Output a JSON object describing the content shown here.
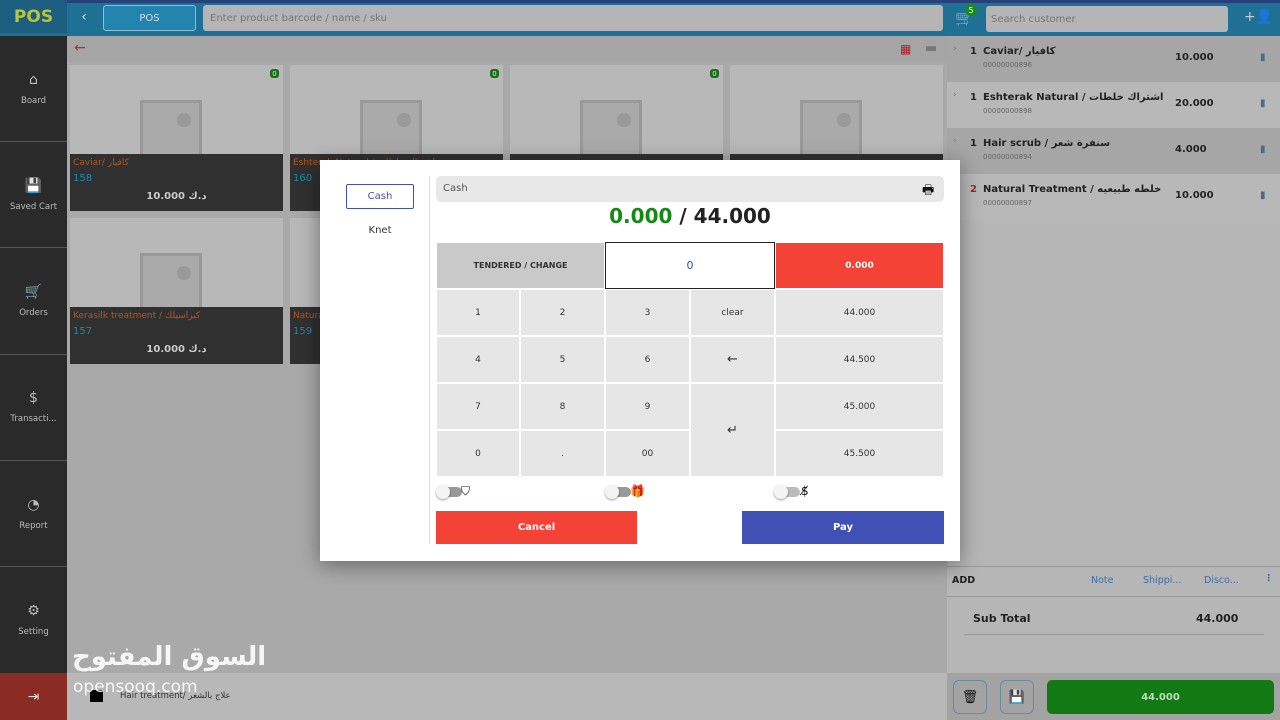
{
  "header": {
    "logo": "POS",
    "back_icon": "chevron-left",
    "pos_label": "POS",
    "product_search_placeholder": "Enter product barcode / name / sku",
    "cart_count": "5",
    "customer_search_placeholder": "Search customer"
  },
  "sidebar": {
    "items": [
      {
        "label": "Board",
        "icon": "⌂"
      },
      {
        "label": "Saved Cart",
        "icon": "💾"
      },
      {
        "label": "Orders",
        "icon": "🛒"
      },
      {
        "label": "Transacti...",
        "icon": "$"
      },
      {
        "label": "Report",
        "icon": "◔"
      },
      {
        "label": "Setting",
        "icon": "⚙"
      }
    ],
    "logout_icon": "⇥"
  },
  "products": [
    {
      "name": "Caviar/ كافيار",
      "code": "158",
      "price": "10.000 د.ك",
      "badge": "0"
    },
    {
      "name": "Eshterak Natural / اشتراك خلطات",
      "code": "160",
      "price": "",
      "badge": "0"
    },
    {
      "name": "",
      "code": "",
      "price": "",
      "badge": "0"
    },
    {
      "name": "",
      "code": "",
      "price": "",
      "badge": ""
    },
    {
      "name": "Kerasilk treatment / كيراسيلك",
      "code": "157",
      "price": "10.000 د.ك",
      "badge": ""
    },
    {
      "name": "Natural Treatment",
      "code": "159",
      "price": "",
      "badge": ""
    }
  ],
  "category_bar": {
    "label": "Hair treatment/ علاج بالشعر"
  },
  "cart": {
    "items": [
      {
        "qty": "1",
        "name": "Caviar/ كافيار",
        "sku": "00000000896",
        "price": "10.000"
      },
      {
        "qty": "1",
        "name": "Eshterak Natural / اشتراك خلطات",
        "sku": "00000000898",
        "price": "20.000"
      },
      {
        "qty": "1",
        "name": "Hair scrub / سنفرة شعر",
        "sku": "00000000894",
        "price": "4.000"
      },
      {
        "qty": "2",
        "name": "Natural Treatment / خلطه طبيعيه",
        "sku": "00000000897",
        "price": "10.000"
      }
    ],
    "add_label": "ADD",
    "note_label": "Note",
    "shipping_label": "Shippi...",
    "discount_label": "Disco...",
    "subtotal_label": "Sub Total",
    "subtotal_value": "44.000",
    "total_button": "44.000"
  },
  "payment_modal": {
    "methods": [
      "Cash",
      "Knet"
    ],
    "selected_method": "Cash",
    "paid": "0.000",
    "separator": "/",
    "total": "44.000",
    "tendered_label": "TENDERED / CHANGE",
    "tendered_value": "0",
    "change_value": "0.000",
    "keys": [
      "1",
      "2",
      "3",
      "clear",
      "4",
      "5",
      "6",
      "←",
      "7",
      "8",
      "9",
      "↵",
      "0",
      ".",
      "00"
    ],
    "quick_amounts": [
      "44.000",
      "44.500",
      "45.000",
      "45.500"
    ],
    "toggles": [
      {
        "icon": "shield-check",
        "on": false
      },
      {
        "icon": "gift-card",
        "on": false
      },
      {
        "icon": "no-currency",
        "on": false
      }
    ],
    "cancel_label": "Cancel",
    "pay_label": "Pay"
  },
  "watermark": {
    "arabic": "السوق المفتوح",
    "latin": "opensooq.com"
  },
  "colors": {
    "primary": "#3f51b5",
    "danger": "#f44336",
    "success": "#148a14"
  }
}
